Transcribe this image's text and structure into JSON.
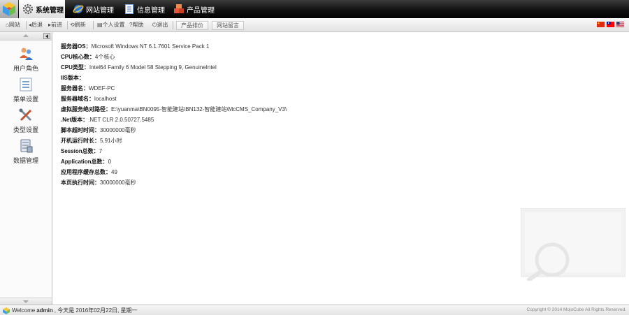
{
  "nav": {
    "tabs": [
      {
        "label": "系统管理",
        "icon": "gear-icon",
        "active": true
      },
      {
        "label": "网站管理",
        "icon": "globe-icon",
        "active": false
      },
      {
        "label": "信息管理",
        "icon": "document-icon",
        "active": false
      },
      {
        "label": "产品管理",
        "icon": "boxes-icon",
        "active": false
      }
    ]
  },
  "toolbar": {
    "items": [
      {
        "label": "网站",
        "icon": "home-icon"
      },
      {
        "label": "后退",
        "icon": "back-arrow-icon"
      },
      {
        "label": "前进",
        "icon": "forward-arrow-icon"
      },
      {
        "label": "刷新",
        "icon": "refresh-icon"
      },
      {
        "label": "个人设置",
        "icon": "settings-icon"
      },
      {
        "label": "帮助",
        "icon": "help-icon"
      },
      {
        "label": "退出",
        "icon": "power-icon"
      }
    ],
    "buttons": [
      "产品排价",
      "网站留言"
    ],
    "flags": [
      "flag-cn-icon",
      "flag-tw-icon",
      "flag-us-icon"
    ]
  },
  "sidebar": {
    "items": [
      {
        "label": "用户角色",
        "icon": "users-icon"
      },
      {
        "label": "菜单设置",
        "icon": "menu-list-icon"
      },
      {
        "label": "类型设置",
        "icon": "tools-icon"
      },
      {
        "label": "数据管理",
        "icon": "database-icon"
      }
    ]
  },
  "info": [
    {
      "key": "服务器OS：",
      "value": "Microsoft Windows NT 6.1.7601 Service Pack 1"
    },
    {
      "key": "CPU核心数：",
      "value": "4个核心"
    },
    {
      "key": "CPU类型：",
      "value": "Intel64 Family 6 Model 58 Stepping 9, GenuineIntel"
    },
    {
      "key": "IIS版本：",
      "value": ""
    },
    {
      "key": "服务器名：",
      "value": "WDEF-PC"
    },
    {
      "key": "服务器域名：",
      "value": "localhost"
    },
    {
      "key": "虚拟服务绝对路径：",
      "value": "E:\\yuanma\\BN0095-智能建站\\BN132-智能建站\\McCMS_Company_V3\\"
    },
    {
      "key": ".Net版本：",
      "value": ".NET CLR 2.0.50727.5485"
    },
    {
      "key": "脚本超时时间：",
      "value": "30000000毫秒"
    },
    {
      "key": "开机运行时长：",
      "value": "5.91小时"
    },
    {
      "key": "Session总数：",
      "value": "7"
    },
    {
      "key": "Application总数：",
      "value": "0"
    },
    {
      "key": "应用程序缓存总数：",
      "value": "49"
    },
    {
      "key": "本页执行时间：",
      "value": "30000000毫秒"
    }
  ],
  "status": {
    "welcome": "Welcome",
    "user": "admin",
    "date": ", 今天是 2016年02月22日, 星期一",
    "copyright": "Copyright © 2014 MojoCube All Rights Reserved."
  }
}
